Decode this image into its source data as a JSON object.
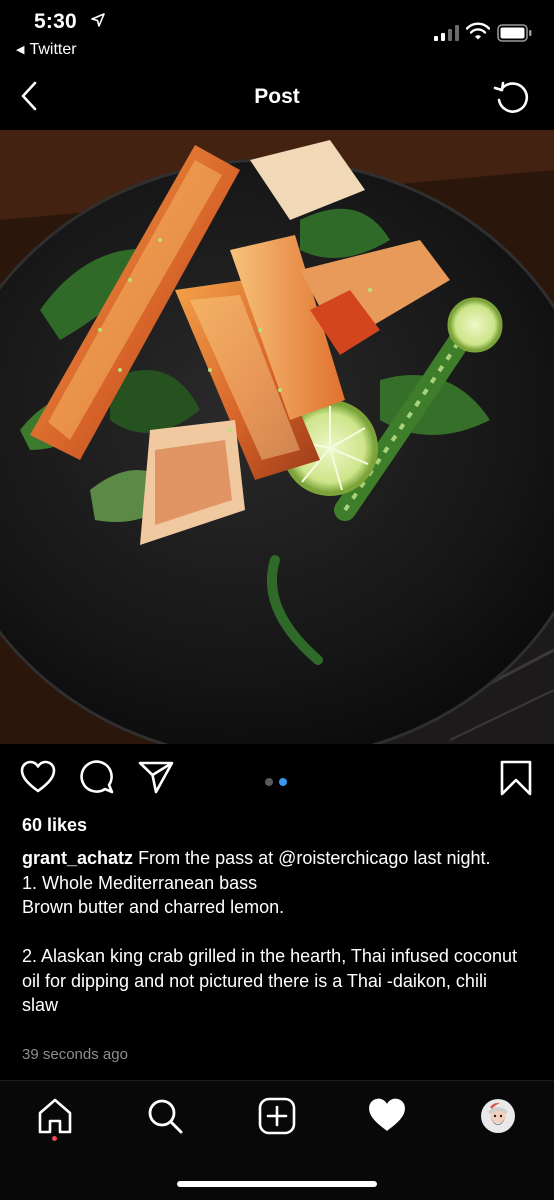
{
  "status_bar": {
    "time": "5:30",
    "back_app": "Twitter",
    "icons": [
      "location-arrow-icon",
      "cellular-signal-icon",
      "wifi-icon",
      "battery-icon"
    ]
  },
  "nav": {
    "title": "Post",
    "icons": [
      "chevron-left-icon",
      "refresh-icon"
    ]
  },
  "post": {
    "image_icon": "food-photo",
    "actions": [
      "heart-icon",
      "comment-icon",
      "share-icon",
      "bookmark-icon"
    ],
    "carousel": {
      "count": 2,
      "active_index": 1,
      "active_color": "#3897f0",
      "inactive_color": "#5a5a5a"
    },
    "likes": "60 likes",
    "username": "grant_achatz",
    "caption_first": "From the pass at @roisterchicago  last night.",
    "caption_lines": [
      "1. Whole Mediterranean bass",
      "Brown butter and charred lemon.",
      "",
      "2. Alaskan king crab grilled in the hearth, Thai infused coconut oil for dipping and not pictured there is a Thai -daikon, chili slaw"
    ],
    "time_ago": "39 seconds ago"
  },
  "tab_bar": {
    "tabs": [
      "home-icon",
      "search-icon",
      "add-post-icon",
      "activity-heart-icon",
      "profile-avatar"
    ],
    "notification_color": "#ed4956"
  }
}
